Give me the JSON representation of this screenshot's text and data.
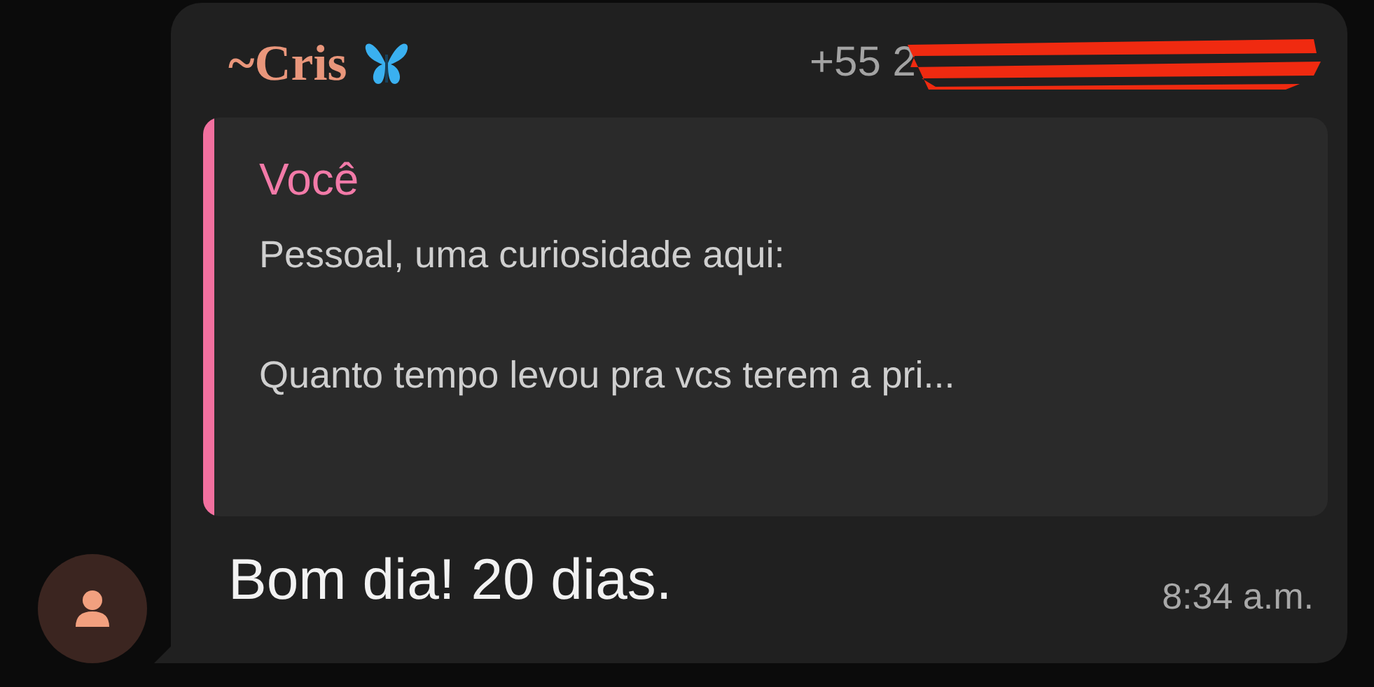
{
  "sender": {
    "name": "~Cris",
    "phone": "+55 2",
    "phone_redacted": true
  },
  "quote": {
    "author": "Você",
    "paragraphs": [
      "Pessoal, uma curiosidade aqui:",
      "Quanto tempo levou pra vcs terem a pri..."
    ]
  },
  "message": {
    "text": "Bom dia! 20 dias.",
    "time": "8:34 a.m."
  }
}
